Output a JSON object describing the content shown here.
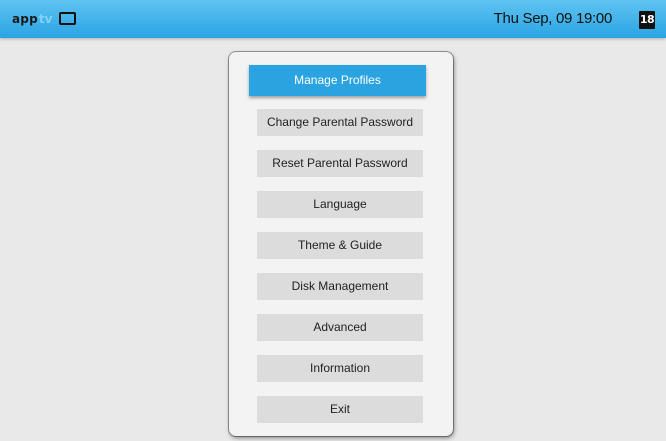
{
  "topbar": {
    "logo_text": "app",
    "logo_accent": "tv",
    "clock": "Thu Sep, 09 19:00",
    "age_rating": "18"
  },
  "menu": {
    "items": [
      {
        "label": "Manage Profiles",
        "selected": true
      },
      {
        "label": "Change Parental Password",
        "selected": false
      },
      {
        "label": "Reset Parental Password",
        "selected": false
      },
      {
        "label": "Language",
        "selected": false
      },
      {
        "label": "Theme & Guide",
        "selected": false
      },
      {
        "label": "Disk Management",
        "selected": false
      },
      {
        "label": "Advanced",
        "selected": false
      },
      {
        "label": "Information",
        "selected": false
      },
      {
        "label": "Exit",
        "selected": false
      }
    ]
  },
  "colors": {
    "topbar": "#2aa4e3",
    "accent": "#2aa3e0",
    "item_bg": "#dcdcdc",
    "background": "#e9e9e9"
  },
  "icons": [
    "tv-icon"
  ]
}
